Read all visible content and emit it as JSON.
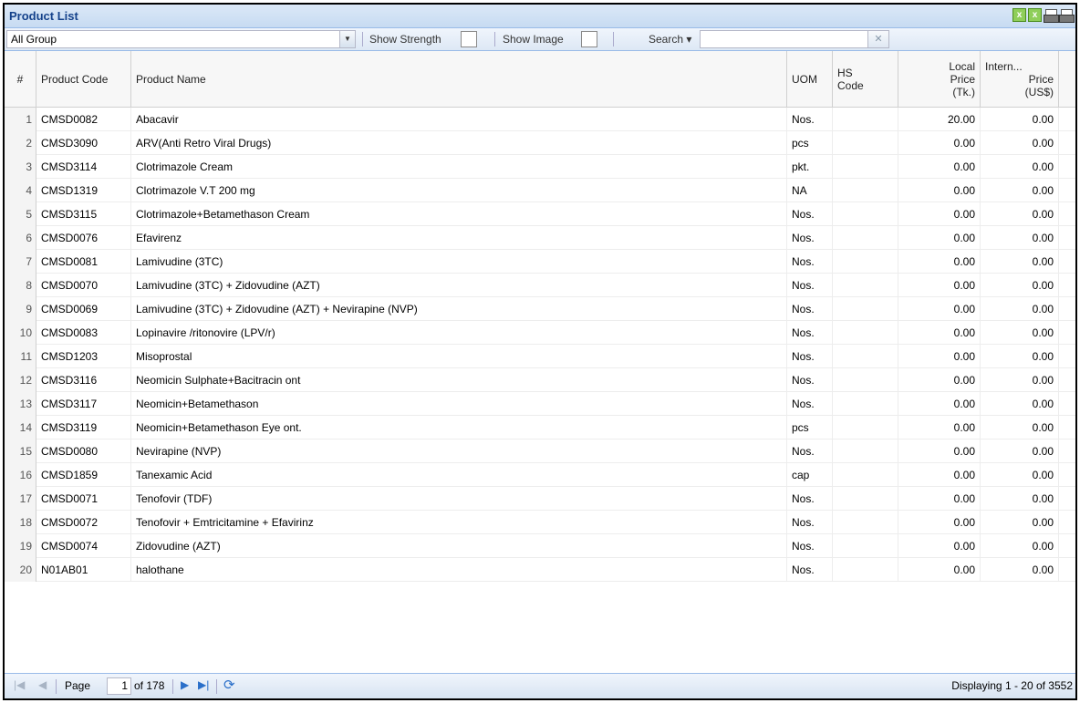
{
  "panel": {
    "title": "Product List"
  },
  "toolbar": {
    "group_value": "All Group",
    "show_strength_label": "Show Strength",
    "show_image_label": "Show Image",
    "search_label": "Search ▾",
    "search_value": ""
  },
  "columns": {
    "num": "#",
    "code": "Product Code",
    "name": "Product Name",
    "uom": "UOM",
    "hs1": "HS",
    "hs2": "Code",
    "lp1": "Local",
    "lp2": "Price",
    "lp3": "(Tk.)",
    "ip1": "Intern...",
    "ip2": "Price",
    "ip3": "(US$)"
  },
  "rows": [
    {
      "n": "1",
      "code": "CMSD0082",
      "name": "Abacavir",
      "uom": "Nos.",
      "hs": "",
      "local": "20.00",
      "intl": "0.00"
    },
    {
      "n": "2",
      "code": "CMSD3090",
      "name": "ARV(Anti Retro Viral Drugs)",
      "uom": "pcs",
      "hs": "",
      "local": "0.00",
      "intl": "0.00"
    },
    {
      "n": "3",
      "code": "CMSD3114",
      "name": "Clotrimazole Cream",
      "uom": "pkt.",
      "hs": "",
      "local": "0.00",
      "intl": "0.00"
    },
    {
      "n": "4",
      "code": "CMSD1319",
      "name": "Clotrimazole V.T 200 mg",
      "uom": "NA",
      "hs": "",
      "local": "0.00",
      "intl": "0.00"
    },
    {
      "n": "5",
      "code": "CMSD3115",
      "name": "Clotrimazole+Betamethason Cream",
      "uom": "Nos.",
      "hs": "",
      "local": "0.00",
      "intl": "0.00"
    },
    {
      "n": "6",
      "code": "CMSD0076",
      "name": "Efavirenz",
      "uom": "Nos.",
      "hs": "",
      "local": "0.00",
      "intl": "0.00"
    },
    {
      "n": "7",
      "code": "CMSD0081",
      "name": "Lamivudine (3TC)",
      "uom": "Nos.",
      "hs": "",
      "local": "0.00",
      "intl": "0.00"
    },
    {
      "n": "8",
      "code": "CMSD0070",
      "name": "Lamivudine (3TC) + Zidovudine (AZT)",
      "uom": "Nos.",
      "hs": "",
      "local": "0.00",
      "intl": "0.00"
    },
    {
      "n": "9",
      "code": "CMSD0069",
      "name": "Lamivudine (3TC) + Zidovudine (AZT) + Nevirapine (NVP)",
      "uom": "Nos.",
      "hs": "",
      "local": "0.00",
      "intl": "0.00"
    },
    {
      "n": "10",
      "code": "CMSD0083",
      "name": "Lopinavire /ritonovire (LPV/r)",
      "uom": "Nos.",
      "hs": "",
      "local": "0.00",
      "intl": "0.00"
    },
    {
      "n": "11",
      "code": "CMSD1203",
      "name": "Misoprostal",
      "uom": "Nos.",
      "hs": "",
      "local": "0.00",
      "intl": "0.00"
    },
    {
      "n": "12",
      "code": "CMSD3116",
      "name": "Neomicin Sulphate+Bacitracin ont",
      "uom": "Nos.",
      "hs": "",
      "local": "0.00",
      "intl": "0.00"
    },
    {
      "n": "13",
      "code": "CMSD3117",
      "name": "Neomicin+Betamethason",
      "uom": "Nos.",
      "hs": "",
      "local": "0.00",
      "intl": "0.00"
    },
    {
      "n": "14",
      "code": "CMSD3119",
      "name": "Neomicin+Betamethason Eye ont.",
      "uom": "pcs",
      "hs": "",
      "local": "0.00",
      "intl": "0.00"
    },
    {
      "n": "15",
      "code": "CMSD0080",
      "name": "Nevirapine (NVP)",
      "uom": "Nos.",
      "hs": "",
      "local": "0.00",
      "intl": "0.00"
    },
    {
      "n": "16",
      "code": "CMSD1859",
      "name": "Tanexamic Acid",
      "uom": "cap",
      "hs": "",
      "local": "0.00",
      "intl": "0.00"
    },
    {
      "n": "17",
      "code": "CMSD0071",
      "name": "Tenofovir (TDF)",
      "uom": "Nos.",
      "hs": "",
      "local": "0.00",
      "intl": "0.00"
    },
    {
      "n": "18",
      "code": "CMSD0072",
      "name": "Tenofovir + Emtricitamine + Efavirinz",
      "uom": "Nos.",
      "hs": "",
      "local": "0.00",
      "intl": "0.00"
    },
    {
      "n": "19",
      "code": "CMSD0074",
      "name": "Zidovudine (AZT)",
      "uom": "Nos.",
      "hs": "",
      "local": "0.00",
      "intl": "0.00"
    },
    {
      "n": "20",
      "code": "N01AB01",
      "name": "halothane",
      "uom": "Nos.",
      "hs": "",
      "local": "0.00",
      "intl": "0.00"
    }
  ],
  "pager": {
    "page_label": "Page",
    "page_value": "1",
    "of_label": "of 178",
    "display_text": "Displaying 1 - 20 of 3552"
  },
  "icons": {
    "excel": "excel-icon",
    "print": "print-icon",
    "first": "first-page-icon",
    "prev": "prev-page-icon",
    "next": "next-page-icon",
    "last": "last-page-icon",
    "refresh": "refresh-icon"
  }
}
